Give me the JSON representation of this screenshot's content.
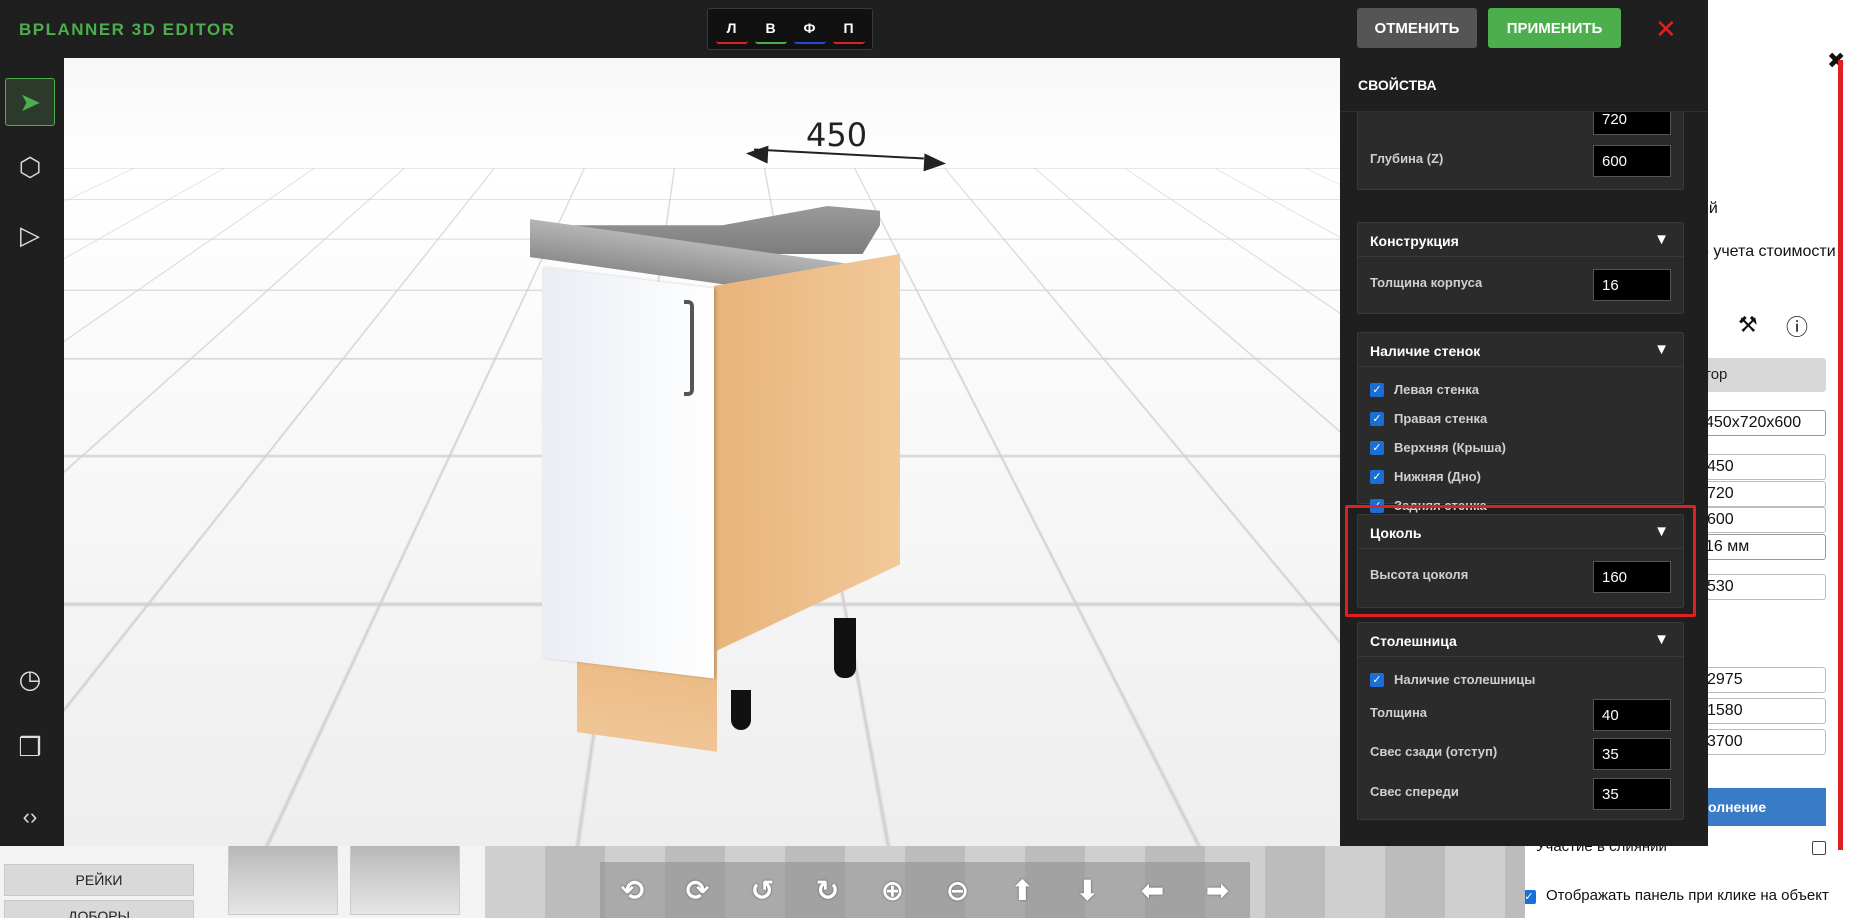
{
  "app": {
    "title": "BPLANNER 3D EDITOR"
  },
  "view_buttons": [
    {
      "label": "Л",
      "color": "#e02020"
    },
    {
      "label": "В",
      "color": "#4cae4c"
    },
    {
      "label": "Ф",
      "color": "#2a4ad6"
    },
    {
      "label": "П",
      "color": "#e02020"
    }
  ],
  "actions": {
    "cancel": "ОТМЕНИТЬ",
    "apply": "ПРИМЕНИТЬ",
    "close": "✕"
  },
  "left_tools": [
    {
      "name": "select-tool",
      "icon": "cursor-icon",
      "glyph": "➤",
      "active": true
    },
    {
      "name": "object-tool",
      "icon": "hexagon-icon",
      "glyph": "⬡",
      "active": false
    },
    {
      "name": "play-tool",
      "icon": "play-icon",
      "glyph": "▷",
      "active": false
    },
    {
      "name": "history-tool",
      "icon": "clock-icon",
      "glyph": "◷",
      "active": false
    },
    {
      "name": "cube-tool",
      "icon": "cube-icon",
      "glyph": "❒",
      "active": false
    },
    {
      "name": "code-tool",
      "icon": "code-icon",
      "glyph": "‹›",
      "active": false
    }
  ],
  "viewport": {
    "dimension_label": "450"
  },
  "properties": {
    "title": "СВОЙСТВА",
    "size": {
      "depth_label": "Глубина (Z)",
      "depth_value": "600",
      "height_value": "720"
    },
    "construction": {
      "title": "Конструкция",
      "thickness_label": "Толщина корпуса",
      "thickness_value": "16"
    },
    "walls": {
      "title": "Наличие стенок",
      "items": [
        "Левая стенка",
        "Правая стенка",
        "Верхняя (Крыша)",
        "Нижняя (Дно)",
        "Задняя стенка"
      ]
    },
    "plinth": {
      "title": "Цоколь",
      "height_label": "Высота цоколя",
      "height_value": "160"
    },
    "countertop": {
      "title": "Столешница",
      "enabled_label": "Наличие столешницы",
      "thickness_label": "Толщина",
      "thickness_value": "40",
      "back_label": "Свес сзади (отступ)",
      "back_value": "35",
      "front_label": "Свес спереди",
      "front_value": "35"
    },
    "toggle_glyph": "▼"
  },
  "background_page": {
    "close_glyph": "✖",
    "text_fragment_1": "ей",
    "text_fragment_2": "е учета стоимости",
    "button_fragment": "тор",
    "select_value": "450x720x600",
    "fields": [
      "450",
      "720",
      "600"
    ],
    "thickness_select": "16 мм",
    "field_530": "530",
    "coord_fields": [
      "2975",
      "1580",
      "3700"
    ],
    "blue_button": "олнение",
    "merge_label": "Участие в слиянии",
    "show_panel_label": "Отображать панель при клике на объект",
    "categories": [
      "РЕЙКИ",
      "ДОБОРЫ"
    ]
  },
  "nav_buttons": [
    {
      "name": "rotate-left-button",
      "glyph": "⟲"
    },
    {
      "name": "rotate-right-button",
      "glyph": "⟳"
    },
    {
      "name": "tilt-up-button",
      "glyph": "↺"
    },
    {
      "name": "tilt-down-button",
      "glyph": "↻"
    },
    {
      "name": "zoom-in-button",
      "glyph": "⊕"
    },
    {
      "name": "zoom-out-button",
      "glyph": "⊖"
    },
    {
      "name": "pan-up-button",
      "glyph": "⬆"
    },
    {
      "name": "pan-down-button",
      "glyph": "⬇"
    },
    {
      "name": "pan-left-button",
      "glyph": "⬅"
    },
    {
      "name": "pan-right-button",
      "glyph": "➡"
    }
  ]
}
